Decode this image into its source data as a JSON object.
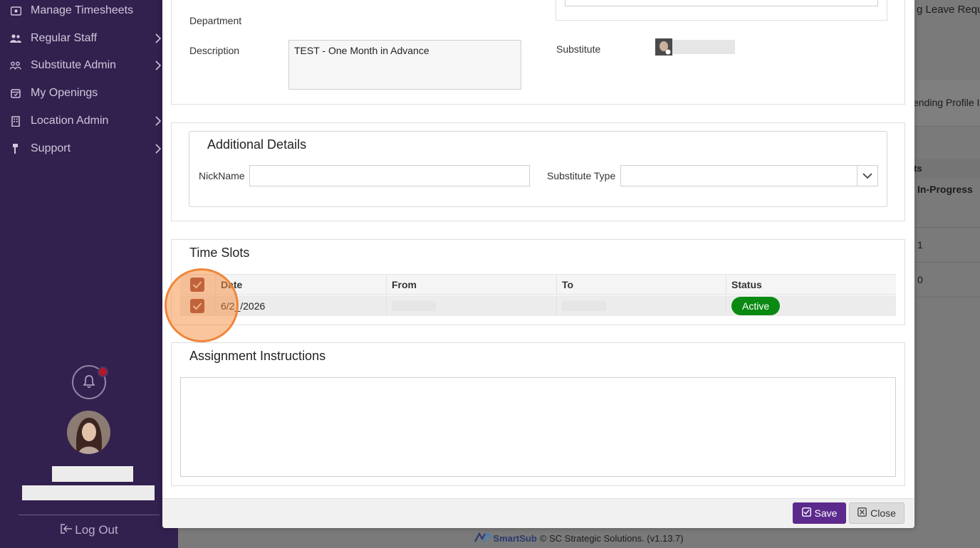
{
  "sidebar": {
    "items": [
      {
        "label": "Manage Timesheets",
        "icon": "timesheet-icon",
        "has_submenu": false
      },
      {
        "label": "Regular Staff",
        "icon": "users-icon",
        "has_submenu": true
      },
      {
        "label": "Substitute Admin",
        "icon": "user-group-icon",
        "has_submenu": true
      },
      {
        "label": "My Openings",
        "icon": "calendar-icon",
        "has_submenu": false
      },
      {
        "label": "Location Admin",
        "icon": "building-icon",
        "has_submenu": true
      },
      {
        "label": "Support",
        "icon": "support-icon",
        "has_submenu": true
      }
    ],
    "logout_label": "Log Out"
  },
  "background": {
    "leave_request_fragment": "g Leave Requ",
    "pending_profile_fragment": "ending Profile I",
    "column_fragment": "ts",
    "in_progress_label": "In-Progress",
    "row_value_1": "1",
    "row_value_2": "0"
  },
  "modal": {
    "department_label": "Department",
    "description_label": "Description",
    "description_value": "TEST - One Month in Advance",
    "substitute_label": "Substitute",
    "additional_details": {
      "title": "Additional Details",
      "nickname_label": "NickName",
      "nickname_value": "",
      "substitute_type_label": "Substitute Type",
      "substitute_type_value": ""
    },
    "time_slots": {
      "title": "Time Slots",
      "columns": [
        "Date",
        "From",
        "To",
        "Status"
      ],
      "rows": [
        {
          "date": "6/2_/2026",
          "from": "",
          "to": "",
          "status": "Active",
          "checked": true
        }
      ],
      "header_checked": true
    },
    "assignment_instructions": {
      "title": "Assignment Instructions",
      "value": ""
    },
    "buttons": {
      "save_label": "Save",
      "close_label": "Close"
    }
  },
  "footer": {
    "brand": "SmartSub",
    "copyright": "© SC Strategic Solutions. (v1.13.7)"
  },
  "colors": {
    "sidebar_bg": "#32204f",
    "save_button": "#5b2a8c",
    "status_active": "#0a8a12",
    "checkbox_checked": "#8a3a3a",
    "notification_dot": "#b0192a",
    "highlight": "#f58c3c"
  }
}
